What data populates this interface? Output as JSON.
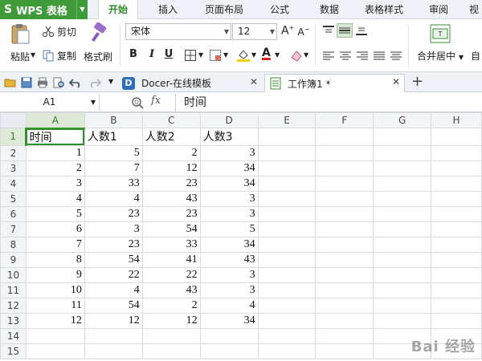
{
  "app": {
    "logo": "S",
    "name": "WPS 表格"
  },
  "menu_tabs": [
    "开始",
    "插入",
    "页面布局",
    "公式",
    "数据",
    "表格样式",
    "审阅",
    "视"
  ],
  "ribbon": {
    "paste": "粘贴",
    "cut": "剪切",
    "copy": "复制",
    "format_painter": "格式刷",
    "font_name": "宋体",
    "font_size": "12",
    "grow_font": "A",
    "shrink_font": "A",
    "bold": "B",
    "italic": "I",
    "underline": "U",
    "merge_center": "合并居中",
    "auto_wrap": "自"
  },
  "doc_tabs": [
    {
      "label": "Docer-在线模板",
      "icon": "D"
    },
    {
      "label": "工作簿1 *"
    }
  ],
  "formula": {
    "name_box": "A1",
    "fx": "fx",
    "value": "时间"
  },
  "columns": [
    "A",
    "B",
    "C",
    "D",
    "E",
    "F",
    "G",
    "H"
  ],
  "rows": [
    {
      "n": "1",
      "cells": [
        "时间",
        "人数1",
        "人数2",
        "人数3"
      ]
    },
    {
      "n": "2",
      "cells": [
        "1",
        "5",
        "2",
        "3"
      ]
    },
    {
      "n": "3",
      "cells": [
        "2",
        "7",
        "12",
        "34"
      ]
    },
    {
      "n": "4",
      "cells": [
        "3",
        "33",
        "23",
        "34"
      ]
    },
    {
      "n": "5",
      "cells": [
        "4",
        "4",
        "43",
        "3"
      ]
    },
    {
      "n": "6",
      "cells": [
        "5",
        "23",
        "23",
        "3"
      ]
    },
    {
      "n": "7",
      "cells": [
        "6",
        "3",
        "54",
        "5"
      ]
    },
    {
      "n": "8",
      "cells": [
        "7",
        "23",
        "33",
        "34"
      ]
    },
    {
      "n": "9",
      "cells": [
        "8",
        "54",
        "41",
        "43"
      ]
    },
    {
      "n": "10",
      "cells": [
        "9",
        "22",
        "22",
        "3"
      ]
    },
    {
      "n": "11",
      "cells": [
        "10",
        "4",
        "43",
        "3"
      ]
    },
    {
      "n": "12",
      "cells": [
        "11",
        "54",
        "2",
        "4"
      ]
    },
    {
      "n": "13",
      "cells": [
        "12",
        "12",
        "12",
        "34"
      ]
    },
    {
      "n": "14",
      "cells": [
        "",
        "",
        "",
        ""
      ]
    },
    {
      "n": "15",
      "cells": [
        "",
        "",
        "",
        ""
      ]
    }
  ],
  "watermark": "Bai 经验",
  "colors": {
    "accent": "#3f9b3a",
    "selection": "#2f8f2a"
  }
}
